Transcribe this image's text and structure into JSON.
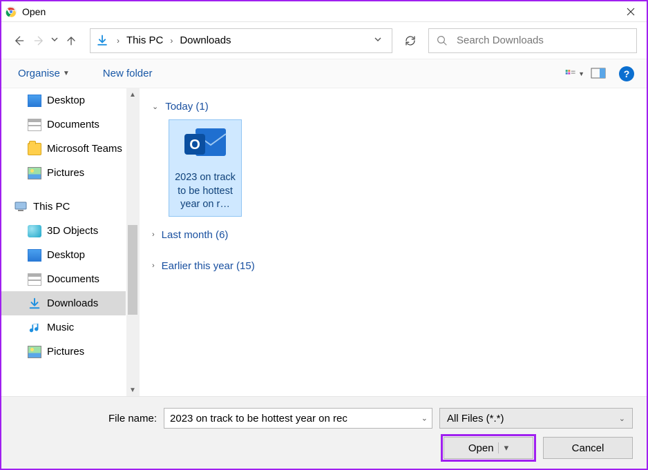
{
  "window": {
    "title": "Open"
  },
  "nav": {
    "refresh_tooltip": "Refresh"
  },
  "breadcrumb": {
    "root": "This PC",
    "current": "Downloads"
  },
  "search": {
    "placeholder": "Search Downloads"
  },
  "toolbar": {
    "organise": "Organise",
    "newfolder": "New folder"
  },
  "sidebar": {
    "items": [
      {
        "icon": "desktop",
        "label": "Desktop",
        "level": 2
      },
      {
        "icon": "doc",
        "label": "Documents",
        "level": 2
      },
      {
        "icon": "folder",
        "label": "Microsoft Teams",
        "level": 2
      },
      {
        "icon": "pic",
        "label": "Pictures",
        "level": 2
      },
      {
        "sep": true
      },
      {
        "icon": "pc",
        "label": "This PC",
        "level": 1
      },
      {
        "icon": "3d",
        "label": "3D Objects",
        "level": 2
      },
      {
        "icon": "desktop",
        "label": "Desktop",
        "level": 2
      },
      {
        "icon": "doc",
        "label": "Documents",
        "level": 2
      },
      {
        "icon": "download",
        "label": "Downloads",
        "level": 2,
        "selected": true
      },
      {
        "icon": "music",
        "label": "Music",
        "level": 2
      },
      {
        "icon": "pic",
        "label": "Pictures",
        "level": 2
      }
    ]
  },
  "groups": {
    "today": {
      "label": "Today",
      "count": 1
    },
    "lastmonth": {
      "label": "Last month",
      "count": 6
    },
    "earlier": {
      "label": "Earlier this year",
      "count": 15
    }
  },
  "files": {
    "selected": {
      "name": "2023 on track to be hottest year on r…",
      "type": "outlook-msg"
    }
  },
  "footer": {
    "filename_label": "File name:",
    "filename_value": "2023 on track to be hottest year on rec",
    "filter": "All Files (*.*)",
    "open": "Open",
    "cancel": "Cancel"
  }
}
